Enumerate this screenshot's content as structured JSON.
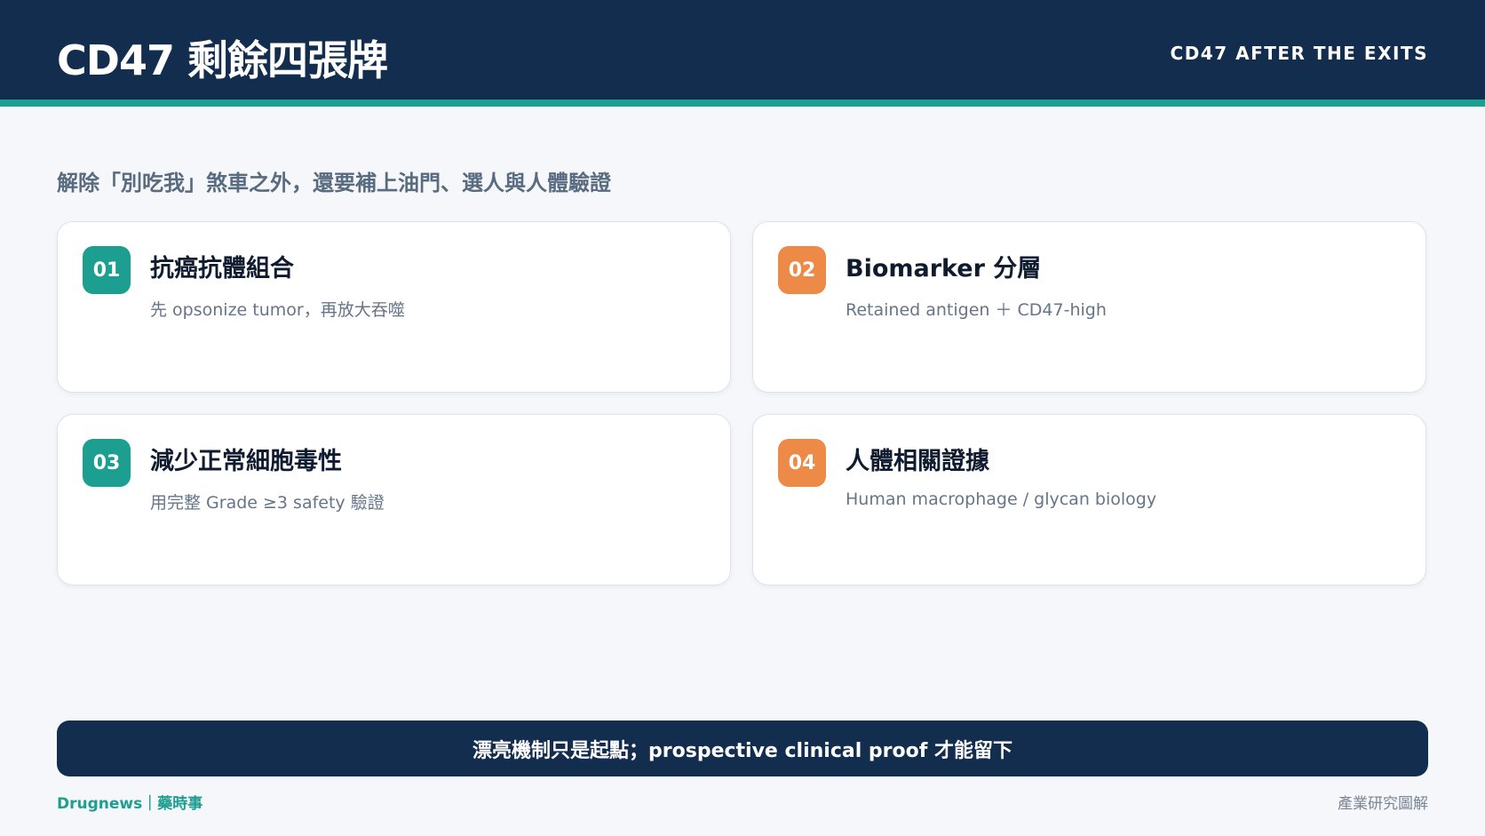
{
  "header": {
    "title": "CD47 剩餘四張牌",
    "subtitle": "CD47 AFTER THE EXITS"
  },
  "lead": "解除「別吃我」煞車之外，還要補上油門、選人與人體驗證",
  "cards": [
    {
      "number": "01",
      "title": "抗癌抗體組合",
      "desc": "先 opsonize tumor，再放大吞噬",
      "badge_color": "#1c9e91"
    },
    {
      "number": "02",
      "title": "Biomarker 分層",
      "desc": "Retained antigen ＋ CD47-high",
      "badge_color": "#ee8a48"
    },
    {
      "number": "03",
      "title": "減少正常細胞毒性",
      "desc": "用完整 Grade ≥3 safety 驗證",
      "badge_color": "#1c9e91"
    },
    {
      "number": "04",
      "title": "人體相關證據",
      "desc": "Human macrophage / glycan biology",
      "badge_color": "#ee8a48"
    }
  ],
  "banner": "漂亮機制只是起點；prospective clinical proof 才能留下",
  "footer": {
    "brand": "Drugnews｜藥時事",
    "tag": "產業研究圖解"
  },
  "colors": {
    "navy": "#132d4f",
    "teal": "#1c9e91",
    "orange": "#ee8a48",
    "background": "#f5f7fa"
  }
}
